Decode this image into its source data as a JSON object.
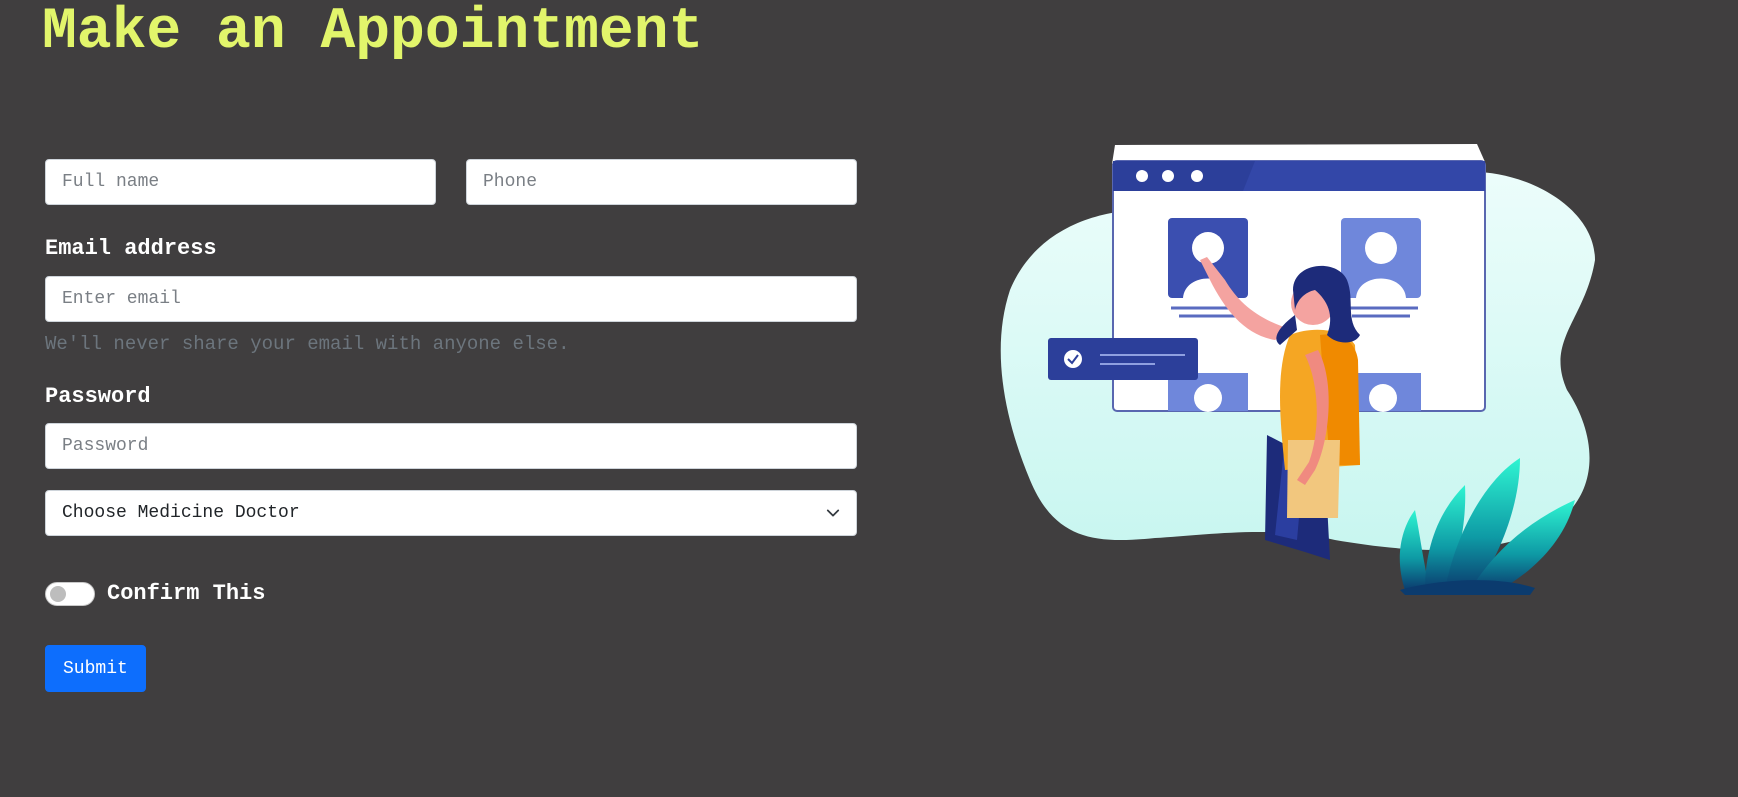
{
  "page": {
    "title": "Make an Appointment"
  },
  "form": {
    "full_name_placeholder": "Full name",
    "phone_placeholder": "Phone",
    "email_label": "Email address",
    "email_placeholder": "Enter email",
    "email_help": "We'll never share your email with anyone else.",
    "password_label": "Password",
    "password_placeholder": "Password",
    "doctor_select": {
      "selected": "Choose Medicine Doctor"
    },
    "confirm_label": "Confirm This",
    "confirm_checked": false,
    "submit_label": "Submit"
  },
  "colors": {
    "background": "#403e3f",
    "title": "#e2f56b",
    "submit_button": "#0d6efd",
    "help_text": "#6c757d"
  },
  "illustration": {
    "description_icon": "video-call-illustration"
  }
}
